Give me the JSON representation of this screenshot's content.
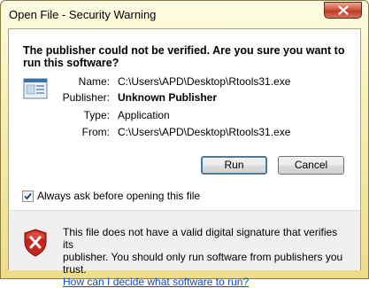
{
  "window": {
    "title": "Open File - Security Warning"
  },
  "heading": "The publisher could not be verified.  Are you sure you want to run this software?",
  "details": [
    {
      "label": "Name:",
      "value": "C:\\Users\\APD\\Desktop\\Rtools31.exe",
      "bold": false
    },
    {
      "label": "Publisher:",
      "value": "Unknown Publisher",
      "bold": true
    },
    {
      "label": "Type:",
      "value": "Application",
      "bold": false
    },
    {
      "label": "From:",
      "value": "C:\\Users\\APD\\Desktop\\Rtools31.exe",
      "bold": false
    }
  ],
  "buttons": {
    "run": "Run",
    "cancel": "Cancel"
  },
  "checkbox": {
    "label": "Always ask before opening this file",
    "checked": true
  },
  "warning": {
    "line1": "This file does not have a valid digital signature that verifies its",
    "line2": "publisher.  You should only run software from publishers you trust.",
    "link": "How can I decide what software to run?"
  },
  "icons": {
    "close": "close-icon",
    "app": "application-icon",
    "shield": "security-shield-icon",
    "check": "checkmark-icon"
  },
  "colors": {
    "link": "#0b4ecf",
    "title_bar": "#f7f1b8",
    "close_button": "#c23a22",
    "shield_red": "#c4261d"
  }
}
